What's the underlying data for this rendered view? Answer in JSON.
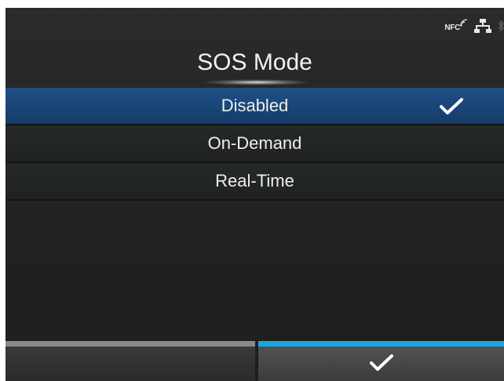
{
  "status_bar": {
    "nfc_text": "NFC",
    "icons": [
      "nfc-icon",
      "network-icon",
      "bluetooth-icon"
    ]
  },
  "screen": {
    "title": "SOS Mode"
  },
  "options": [
    {
      "label": "Disabled",
      "selected": true
    },
    {
      "label": "On-Demand",
      "selected": false
    },
    {
      "label": "Real-Time",
      "selected": false
    }
  ],
  "footer": {
    "left_button_icon": "none",
    "right_button_icon": "checkmark-icon"
  },
  "colors": {
    "selected_row": "#1a4577",
    "accent_bar": "#18a7e6",
    "inactive_bar": "#8a8a8a"
  }
}
